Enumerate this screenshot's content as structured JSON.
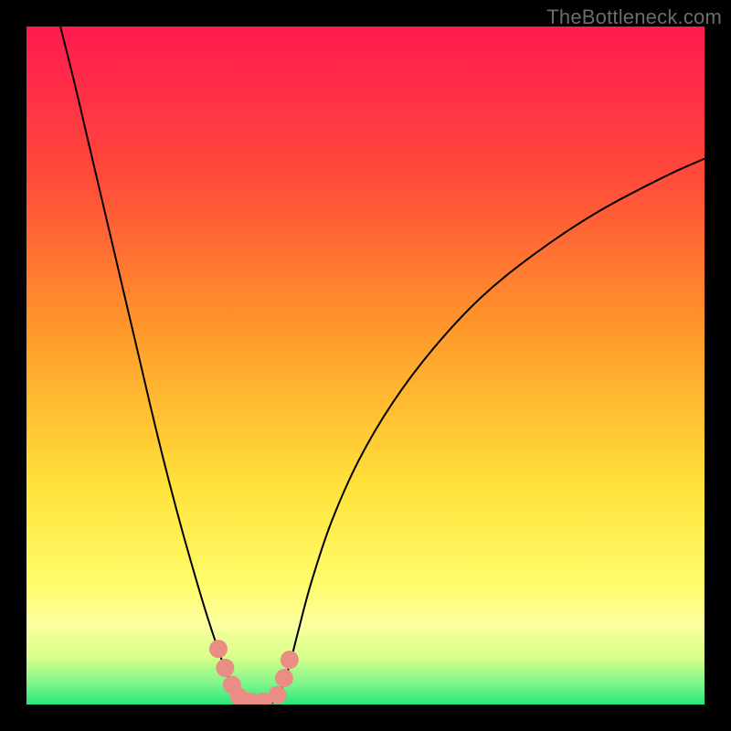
{
  "watermark": "TheBottleneck.com",
  "chart_data": {
    "type": "line",
    "title": "",
    "xlabel": "",
    "ylabel": "",
    "xlim": [
      0,
      100
    ],
    "ylim": [
      0,
      100
    ],
    "grid": false,
    "legend": false,
    "background_gradient": {
      "stops": [
        {
          "offset": 0.0,
          "color": "#ff1a50"
        },
        {
          "offset": 0.22,
          "color": "#ff4a3a"
        },
        {
          "offset": 0.45,
          "color": "#ff992a"
        },
        {
          "offset": 0.68,
          "color": "#ffe33a"
        },
        {
          "offset": 0.82,
          "color": "#fffc6a"
        },
        {
          "offset": 0.88,
          "color": "#fdff9f"
        },
        {
          "offset": 0.93,
          "color": "#d8ff8a"
        },
        {
          "offset": 0.97,
          "color": "#7cf58a"
        },
        {
          "offset": 1.0,
          "color": "#26e87a"
        }
      ]
    },
    "series": [
      {
        "name": "left-branch",
        "x": [
          5.0,
          7.0,
          9.0,
          11.0,
          13.0,
          15.0,
          17.0,
          19.0,
          21.0,
          23.0,
          25.0,
          26.5,
          27.8,
          29.0,
          30.0,
          31.0,
          31.8
        ],
        "y": [
          100.0,
          92.0,
          83.5,
          75.0,
          66.5,
          58.0,
          49.5,
          41.0,
          33.0,
          25.5,
          18.5,
          13.5,
          9.5,
          6.0,
          3.5,
          1.5,
          0.3
        ]
      },
      {
        "name": "right-branch",
        "x": [
          36.5,
          37.5,
          38.7,
          40.0,
          42.0,
          45.0,
          49.0,
          54.0,
          60.0,
          67.0,
          75.0,
          84.0,
          94.0,
          100.0
        ],
        "y": [
          0.3,
          2.0,
          5.5,
          10.5,
          18.0,
          27.0,
          36.0,
          44.5,
          52.5,
          60.0,
          66.5,
          72.5,
          77.8,
          80.5
        ]
      },
      {
        "name": "valley-floor",
        "x": [
          31.8,
          33.0,
          34.5,
          36.5
        ],
        "y": [
          0.3,
          0.0,
          0.0,
          0.3
        ]
      }
    ],
    "markers": {
      "name": "highlight-dots",
      "color": "#e98d85",
      "radius_px": 10,
      "points": [
        {
          "x": 28.3,
          "y": 8.2
        },
        {
          "x": 29.3,
          "y": 5.4
        },
        {
          "x": 30.3,
          "y": 2.9
        },
        {
          "x": 31.4,
          "y": 1.1
        },
        {
          "x": 33.1,
          "y": 0.4
        },
        {
          "x": 34.9,
          "y": 0.4
        },
        {
          "x": 37.0,
          "y": 1.4
        },
        {
          "x": 38.0,
          "y": 3.9
        },
        {
          "x": 38.8,
          "y": 6.6
        }
      ]
    }
  }
}
